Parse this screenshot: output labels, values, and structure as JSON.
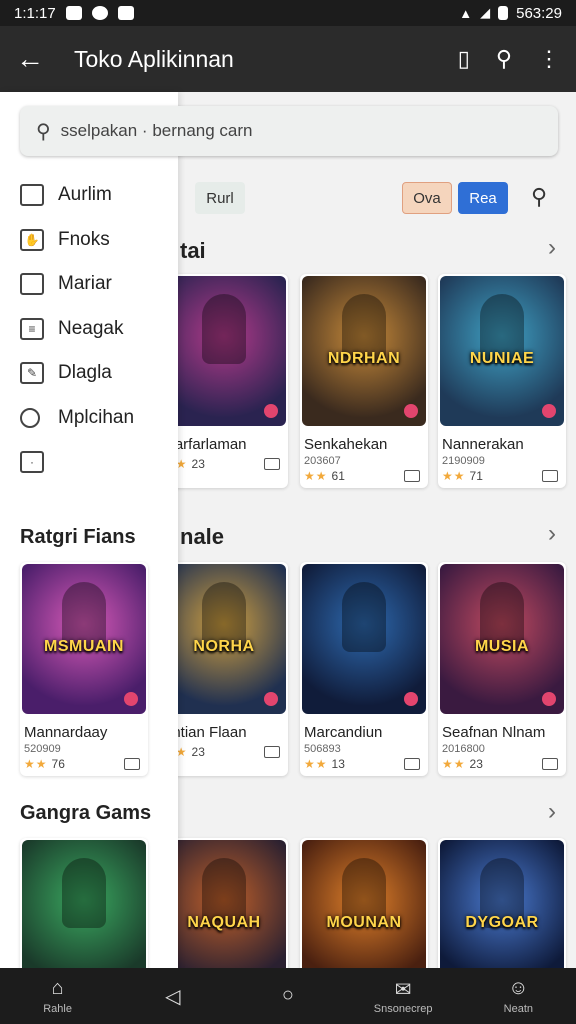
{
  "status_bar": {
    "time": "1:1:17",
    "right_text": "563:29"
  },
  "app_bar": {
    "back_icon": "arrow-left-icon",
    "title": "Toko Aplikinnan"
  },
  "search": {
    "placeholder": "sselpakan · bernang carn"
  },
  "chips": {
    "chip1": "Rurl",
    "chip2": "Ova",
    "chip3": "Rea"
  },
  "drawer": {
    "items": [
      {
        "label": "Aurlim",
        "icon": "calendar-icon"
      },
      {
        "label": "Fnoks",
        "icon": "hand-icon"
      },
      {
        "label": "Mariar",
        "icon": "clipboard-icon"
      },
      {
        "label": "Neagak",
        "icon": "list-icon"
      },
      {
        "label": "Dlagla",
        "icon": "edit-icon"
      },
      {
        "label": "Mplcihan",
        "icon": "search-icon"
      },
      {
        "label": "",
        "icon": "square-icon"
      }
    ],
    "sections": [
      {
        "title": "Ratgri Fians"
      },
      {
        "title": "Gangra Gams"
      }
    ]
  },
  "sections": [
    {
      "title": "tai"
    },
    {
      "title": "nale"
    }
  ],
  "cards": {
    "row1": [
      {
        "name": "Narfarlaman",
        "sub": "",
        "rating": "23",
        "logo": "",
        "colors": [
          "#2a2350",
          "#b23a8a"
        ]
      },
      {
        "name": "Senkahekan",
        "sub": "203607",
        "rating": "61",
        "logo": "NDRHAN",
        "colors": [
          "#3a2a1e",
          "#c78a3a"
        ]
      },
      {
        "name": "Nannerakan",
        "sub": "2190909",
        "rating": "71",
        "logo": "NUNIAE",
        "colors": [
          "#1f3a58",
          "#3fa1c4"
        ]
      }
    ],
    "row2": [
      {
        "name": "Mannardaay",
        "sub": "520909",
        "rating": "76",
        "logo": "MSMUAIN",
        "colors": [
          "#4a1e6a",
          "#d85ab8"
        ]
      },
      {
        "name": "antian Flaan",
        "sub": "",
        "rating": "23",
        "logo": "NORHA",
        "colors": [
          "#203050",
          "#d0a040"
        ]
      },
      {
        "name": "Marcandiun",
        "sub": "506893",
        "rating": "13",
        "logo": "",
        "colors": [
          "#101c3a",
          "#2e6ab0"
        ]
      },
      {
        "name": "Seafnan Nlnam",
        "sub": "2016800",
        "rating": "23",
        "logo": "MUSIA",
        "colors": [
          "#3a1a40",
          "#c04a60"
        ]
      }
    ],
    "row3": [
      {
        "name": "",
        "logo": "",
        "colors": [
          "#1a3a2a",
          "#3aa860"
        ]
      },
      {
        "name": "",
        "logo": "NAQUAH",
        "colors": [
          "#2a2030",
          "#c0602a"
        ]
      },
      {
        "name": "",
        "logo": "MOUNAN",
        "colors": [
          "#4a2010",
          "#e0802a"
        ]
      },
      {
        "name": "",
        "logo": "DYGOAR",
        "colors": [
          "#0e1a3a",
          "#4a7ad0"
        ]
      }
    ]
  },
  "nav": {
    "items": [
      {
        "label": "Rahle",
        "icon": "home-icon"
      },
      {
        "label": "",
        "icon": "back-triangle-icon"
      },
      {
        "label": "",
        "icon": "home-circle-icon"
      },
      {
        "label": "Snsonecrep",
        "icon": "inbox-icon"
      },
      {
        "label": "Neatn",
        "icon": "person-icon"
      }
    ]
  }
}
